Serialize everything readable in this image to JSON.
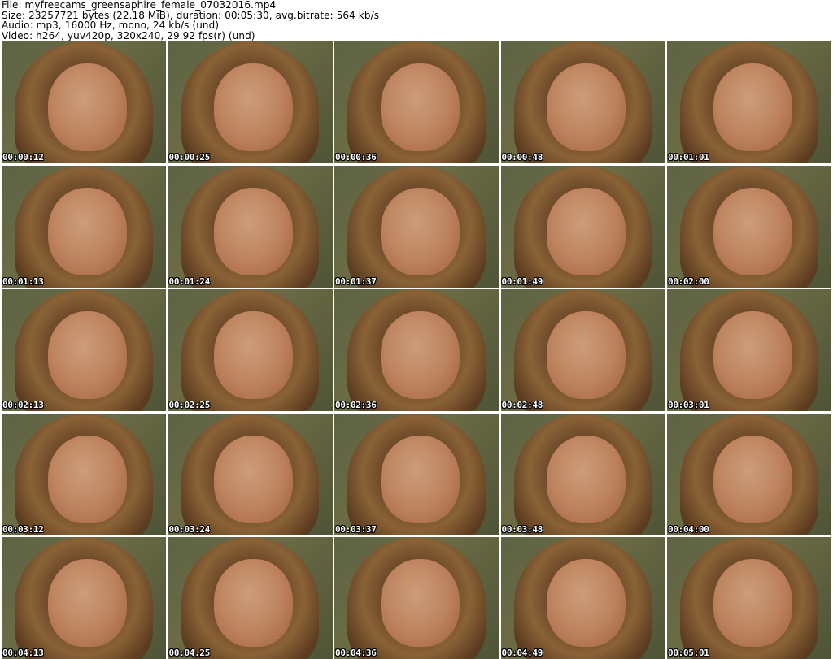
{
  "header": {
    "file": "File: myfreecams_greensaphire_female_07032016.mp4",
    "size": "Size: 23257721 bytes (22.18 MiB), duration: 00:05:30, avg.bitrate: 564 kb/s",
    "audio": "Audio: mp3, 16000 Hz, mono, 24 kb/s (und)",
    "video": "Video: h264, yuv420p, 320x240, 29.92 fps(r) (und)"
  },
  "thumbnails": [
    {
      "timestamp": "00:00:12"
    },
    {
      "timestamp": "00:00:25"
    },
    {
      "timestamp": "00:00:36"
    },
    {
      "timestamp": "00:00:48"
    },
    {
      "timestamp": "00:01:01"
    },
    {
      "timestamp": "00:01:13"
    },
    {
      "timestamp": "00:01:24"
    },
    {
      "timestamp": "00:01:37"
    },
    {
      "timestamp": "00:01:49"
    },
    {
      "timestamp": "00:02:00"
    },
    {
      "timestamp": "00:02:13"
    },
    {
      "timestamp": "00:02:25"
    },
    {
      "timestamp": "00:02:36"
    },
    {
      "timestamp": "00:02:48"
    },
    {
      "timestamp": "00:03:01"
    },
    {
      "timestamp": "00:03:12"
    },
    {
      "timestamp": "00:03:24"
    },
    {
      "timestamp": "00:03:37"
    },
    {
      "timestamp": "00:03:48"
    },
    {
      "timestamp": "00:04:00"
    },
    {
      "timestamp": "00:04:13"
    },
    {
      "timestamp": "00:04:25"
    },
    {
      "timestamp": "00:04:36"
    },
    {
      "timestamp": "00:04:49"
    },
    {
      "timestamp": "00:05:01"
    }
  ]
}
